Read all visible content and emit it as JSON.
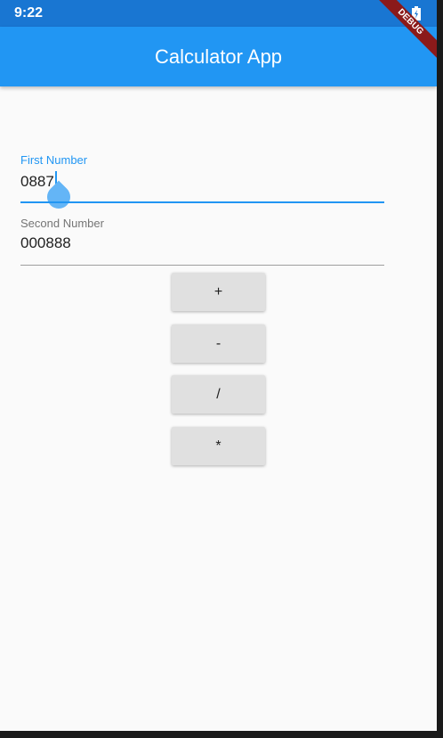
{
  "status_bar": {
    "time": "9:22",
    "icons": [
      "wifi-icon",
      "battery-charging-icon"
    ]
  },
  "debug_banner": "DEBUG",
  "app_bar": {
    "title": "Calculator App",
    "color": "#2196f3"
  },
  "form": {
    "first_number": {
      "label": "First Number",
      "value": "0887",
      "focused": true
    },
    "second_number": {
      "label": "Second Number",
      "value": "000888"
    }
  },
  "buttons": [
    {
      "label": "+"
    },
    {
      "label": "-"
    },
    {
      "label": "/"
    },
    {
      "label": "*"
    }
  ],
  "colors": {
    "primary": "#2196f3",
    "status_bar": "#1976d2",
    "button_bg": "#e0e0e0",
    "background": "#fafafa",
    "debug_banner": "#8b1a1a"
  }
}
